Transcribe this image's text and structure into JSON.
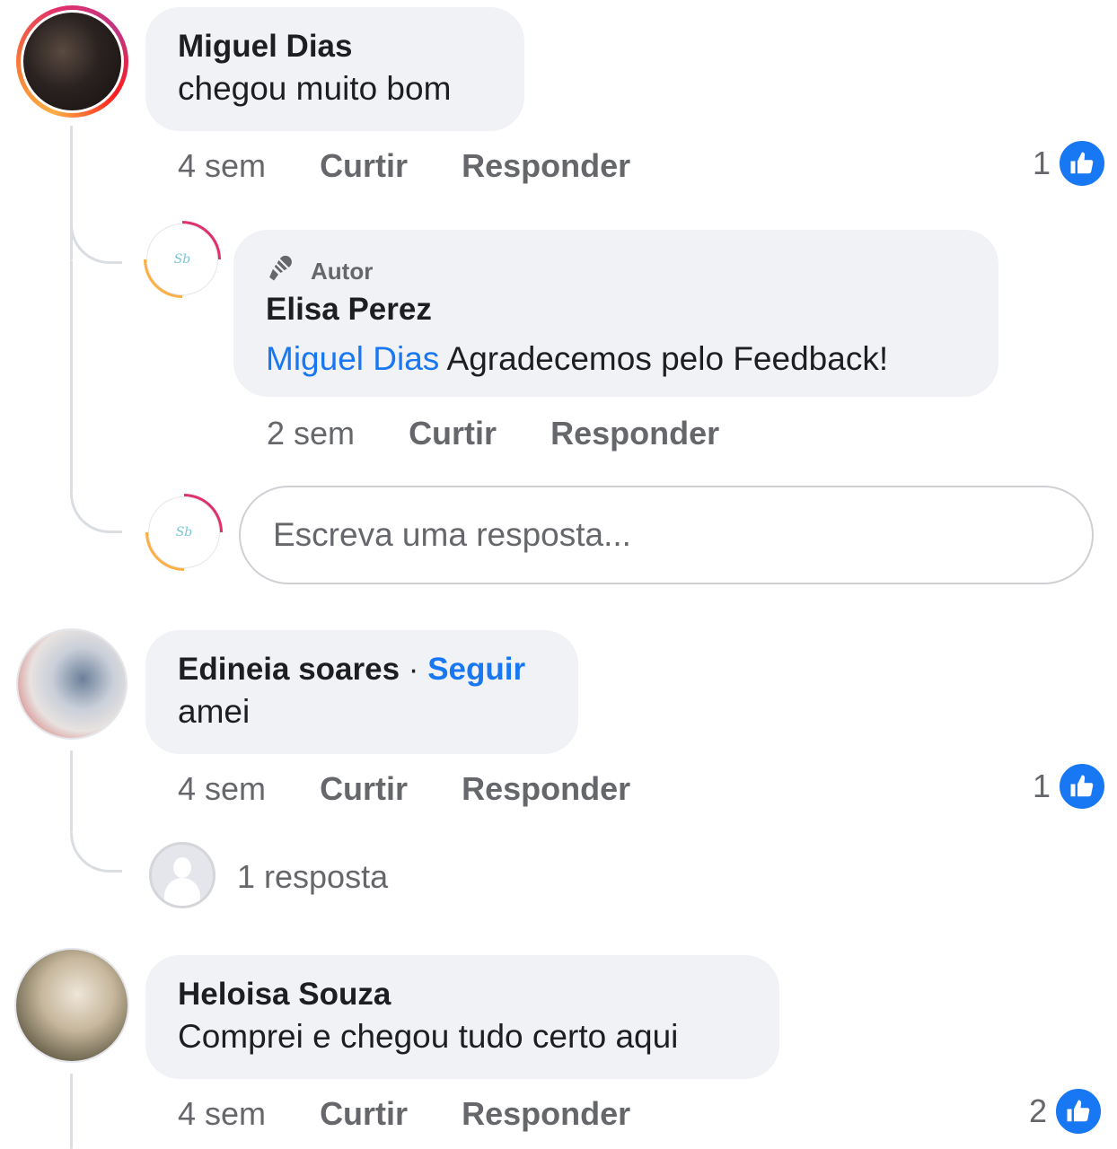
{
  "comments": [
    {
      "author": "Miguel Dias",
      "text": "chegou muito bom",
      "time": "4 sem",
      "like_label": "Curtir",
      "reply_label": "Responder",
      "like_count": "1",
      "reply": {
        "badge": "Autor",
        "author": "Elisa Perez",
        "mention": "Miguel Dias",
        "text": " Agradecemos pelo Feedback!",
        "time": "2 sem",
        "like_label": "Curtir",
        "reply_label": "Responder"
      },
      "reply_input_placeholder": "Escreva uma resposta..."
    },
    {
      "author": "Edineia soares",
      "separator": " · ",
      "follow_label": "Seguir",
      "text": "amei",
      "time": "4 sem",
      "like_label": "Curtir",
      "reply_label": "Responder",
      "like_count": "1",
      "replies_summary": "1 resposta"
    },
    {
      "author": "Heloisa Souza",
      "text": "Comprei e chegou tudo certo aqui",
      "time": "4 sem",
      "like_label": "Curtir",
      "reply_label": "Responder",
      "like_count": "2"
    }
  ],
  "colors": {
    "link": "#1877f2",
    "bubble": "#f0f2f5",
    "meta": "#65676b"
  },
  "icons": {
    "like": "thumbs-up-icon",
    "author_badge": "microphone-icon"
  }
}
